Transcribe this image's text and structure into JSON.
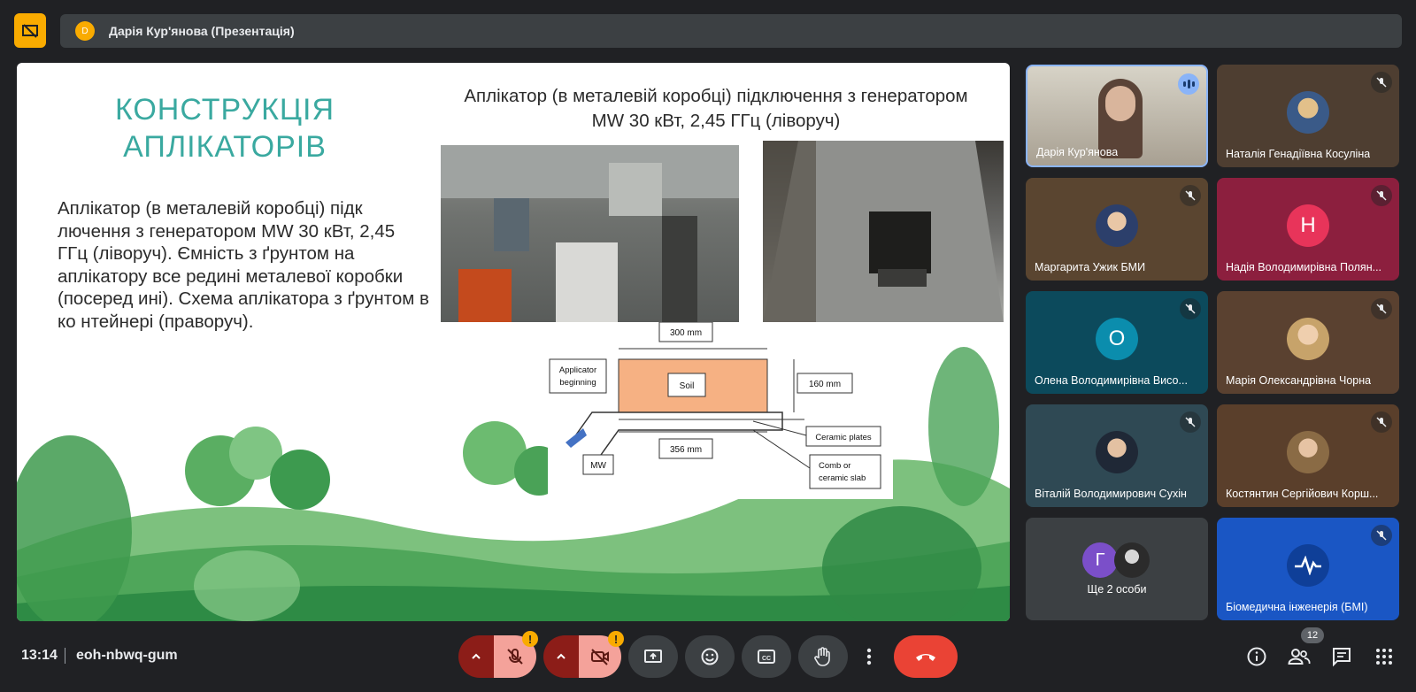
{
  "top_bar": {
    "presenter_initial": "D",
    "presenter_label": "Дарія Кур'янова (Презентація)"
  },
  "slide": {
    "title": "КОНСТРУКЦІЯ АПЛІКАТОРІВ",
    "heading": "Аплікатор (в металевій коробці) підключення з генератором  MW 30 кВт, 2,45 ГГц (ліворуч)",
    "body": "Аплікатор (в металевій коробці) підк лючення з генератором MW 30 кВт, 2,45 ГГц (ліворуч). Ємність з ґрунтом на аплікатору все редині металевої коробки (посеред ині). Схема аплікатора з ґрунтом в ко нтейнері (праворуч).",
    "diagram": {
      "width_label": "300 mm",
      "height_label": "160 mm",
      "bottom_label": "356 mm",
      "soil_label": "Soil",
      "applicator_label_1": "Applicator",
      "applicator_label_2": "beginning",
      "mw_label": "MW",
      "ceramic_label": "Ceramic plates",
      "comb_label_1": "Comb or",
      "comb_label_2": "ceramic slab"
    }
  },
  "participants": [
    {
      "name": "Дарія Кур'янова",
      "type": "video",
      "speaking": true
    },
    {
      "name": "Наталія Генадіївна Косуліна",
      "type": "photo",
      "muted": true
    },
    {
      "name": "Маргарита Ужик БМИ",
      "type": "photo",
      "muted": true
    },
    {
      "name": "Надія Володимирівна Полян...",
      "type": "letter",
      "letter": "Н",
      "color": "#e8345a",
      "muted": true
    },
    {
      "name": "Олена Володимирівна Висо...",
      "type": "letter",
      "letter": "О",
      "color": "#0b8dad",
      "muted": true
    },
    {
      "name": "Марія Олександрівна Чорна",
      "type": "photo",
      "muted": true
    },
    {
      "name": "Віталій Володимирович Сухін",
      "type": "photo",
      "muted": true
    },
    {
      "name": "Костянтин Сергійович Корш...",
      "type": "photo",
      "muted": true
    },
    {
      "name": "Біомедична інженерія (БМІ)",
      "type": "logo",
      "muted": true
    }
  ],
  "others_tile": {
    "label": "Ще 2 особи",
    "letter": "Г"
  },
  "bottom_bar": {
    "time": "13:14",
    "meeting_code": "eoh-nbwq-gum",
    "people_count": "12",
    "warning_glyph": "!"
  },
  "colors": {
    "background": "#202124",
    "accent_yellow": "#f9ab00",
    "hangup_red": "#ea4335",
    "title_teal": "#3aa9a0"
  }
}
